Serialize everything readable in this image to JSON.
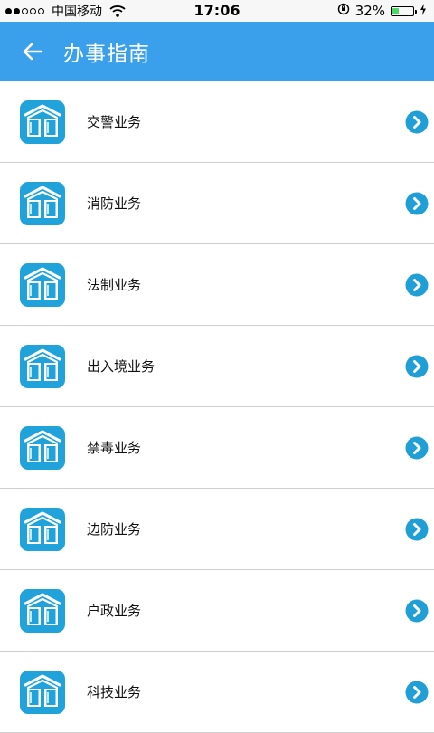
{
  "status_bar": {
    "carrier": "中国移动",
    "time": "17:06",
    "battery_percent": "32%",
    "battery_level": 0.32,
    "signal_dots_filled": 2,
    "signal_dots_total": 5
  },
  "header": {
    "title": "办事指南",
    "background_color": "#3ba0eb",
    "back_icon": "arrow-left-icon"
  },
  "colors": {
    "accent": "#3ba0eb",
    "icon_tile": "#1fa3da",
    "chevron": "#1f9fd6",
    "divider": "#cfcfcf"
  },
  "list": {
    "item_icon": "book-house-icon",
    "chevron_icon": "chevron-right-circle-icon",
    "items": [
      {
        "label": "交警业务"
      },
      {
        "label": "消防业务"
      },
      {
        "label": "法制业务"
      },
      {
        "label": "出入境业务"
      },
      {
        "label": "禁毒业务"
      },
      {
        "label": "边防业务"
      },
      {
        "label": "户政业务"
      },
      {
        "label": "科技业务"
      }
    ]
  }
}
